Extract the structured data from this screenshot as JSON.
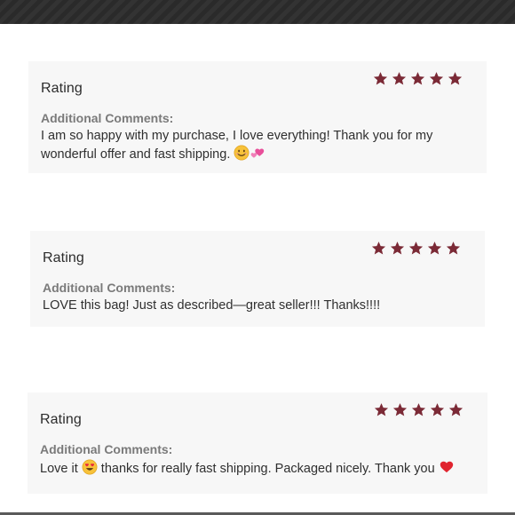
{
  "colors": {
    "star": "#7b2a36",
    "card_background": "#f7f7f7",
    "label_gray": "#7a7a7a"
  },
  "reviews": [
    {
      "rating_label": "Rating",
      "stars": 5,
      "comments_label": "Additional Comments:",
      "comment_text": "I am so happy with my purchase, I love everything! Thank you for my wonderful offer and fast shipping.",
      "emojis": [
        "smiling-face-emoji",
        "pink-hearts-emoji"
      ]
    },
    {
      "rating_label": "Rating",
      "stars": 5,
      "comments_label": "Additional Comments:",
      "comment_text": "LOVE this bag! Just as described—great seller!!! Thanks!!!!"
    },
    {
      "rating_label": "Rating",
      "stars": 5,
      "comments_label": "Additional Comments:",
      "comment_part1": "Love it",
      "comment_part2": "thanks for really fast shipping. Packaged nicely. Thank you",
      "emojis": [
        "heart-eyes-emoji",
        "red-heart-emoji"
      ]
    }
  ]
}
